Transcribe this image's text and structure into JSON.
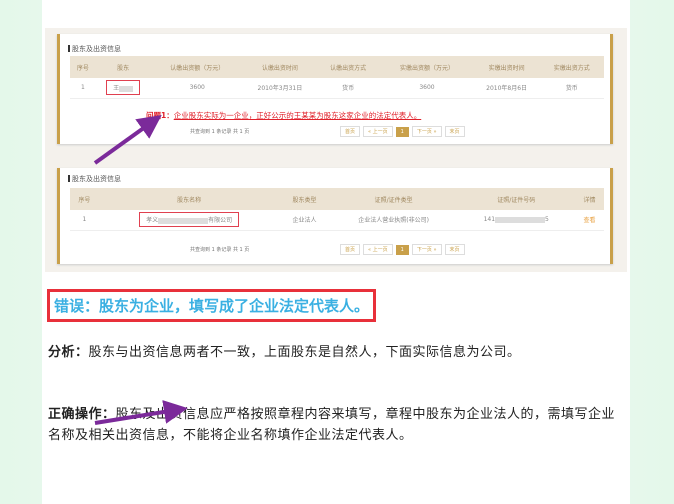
{
  "table1": {
    "section_title": "股东及出资信息",
    "headers": [
      "序号",
      "股东",
      "认缴出资额（万元）",
      "认缴出资时间",
      "认缴出资方式",
      "实缴出资额（万元）",
      "实缴出资时间",
      "实缴出资方式"
    ],
    "row": [
      "1",
      "王",
      "3600",
      "2010年3月31日",
      "货币",
      "3600",
      "2010年8月6日",
      "货币"
    ],
    "note_prefix": "问题1：",
    "note": "企业股东实际为一企业，正好公示的王某某为股东这家企业的法定代表人。",
    "count": "共查询到 1 条记录 共 1 页"
  },
  "table2": {
    "section_title": "股东及出资信息",
    "headers": [
      "序号",
      "股东名称",
      "股东类型",
      "证照/证件类型",
      "证照/证件号码",
      "详情"
    ],
    "row": {
      "no": "1",
      "name_prefix": "孝义",
      "name_suffix": "有限公司",
      "type": "企业法人",
      "id_type": "企业法人营业执照(非公司)",
      "id_prefix": "141",
      "id_suffix": "5",
      "detail": "查看"
    },
    "count": "共查询到 1 条记录 共 1 页"
  },
  "pager": {
    "first": "首页",
    "prev": "« 上一页",
    "current": "1",
    "next": "下一页 »",
    "last": "末页"
  },
  "heading": "错误：股东为企业，填写成了企业法定代表人。",
  "analysis": {
    "label": "分析：",
    "text": "股东与出资信息两者不一致，上面股东是自然人，下面实际信息为公司。"
  },
  "correct": {
    "label": "正确操作：",
    "text": "股东及出资信息应严格按照章程内容来填写，章程中股东为企业法人的，需填写企业名称及相关出资信息，不能将企业名称填作企业法定代表人。"
  },
  "colors": {
    "accent": "#c9a04a",
    "error": "#e8303a",
    "heading": "#3ab0e2",
    "arrow": "#7b2a9a"
  }
}
